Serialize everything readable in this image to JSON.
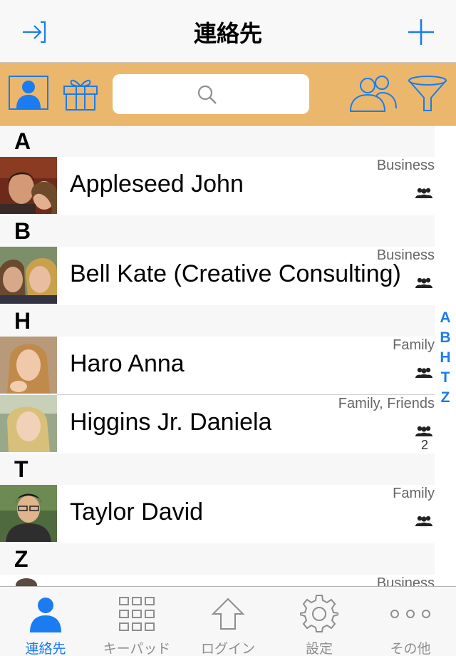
{
  "nav": {
    "title": "連絡先"
  },
  "toolbar": {
    "search_placeholder": ""
  },
  "sections": [
    {
      "letter": "A",
      "contacts": [
        {
          "name": "Appleseed John",
          "group": "Business",
          "count": ""
        }
      ]
    },
    {
      "letter": "B",
      "contacts": [
        {
          "name": "Bell Kate (Creative Consulting)",
          "group": "Business",
          "count": ""
        }
      ]
    },
    {
      "letter": "H",
      "contacts": [
        {
          "name": "Haro Anna",
          "group": "Family",
          "count": ""
        },
        {
          "name": "Higgins Jr. Daniela",
          "group": "Family, Friends",
          "count": "2"
        }
      ]
    },
    {
      "letter": "T",
      "contacts": [
        {
          "name": "Taylor David",
          "group": "Family",
          "count": ""
        }
      ]
    },
    {
      "letter": "Z",
      "contacts": [
        {
          "name": "",
          "group": "Business",
          "count": ""
        }
      ]
    }
  ],
  "index": [
    "A",
    "B",
    "H",
    "T",
    "Z"
  ],
  "tabs": [
    {
      "label": "連絡先",
      "icon": "person-icon",
      "active": true
    },
    {
      "label": "キーパッド",
      "icon": "keypad-icon",
      "active": false
    },
    {
      "label": "ログイン",
      "icon": "upload-arrow-icon",
      "active": false
    },
    {
      "label": "設定",
      "icon": "gear-icon",
      "active": false
    },
    {
      "label": "その他",
      "icon": "more-dots-icon",
      "active": false
    }
  ],
  "colors": {
    "accent": "#1a7cf0",
    "toolbar": "#ebb76c"
  }
}
